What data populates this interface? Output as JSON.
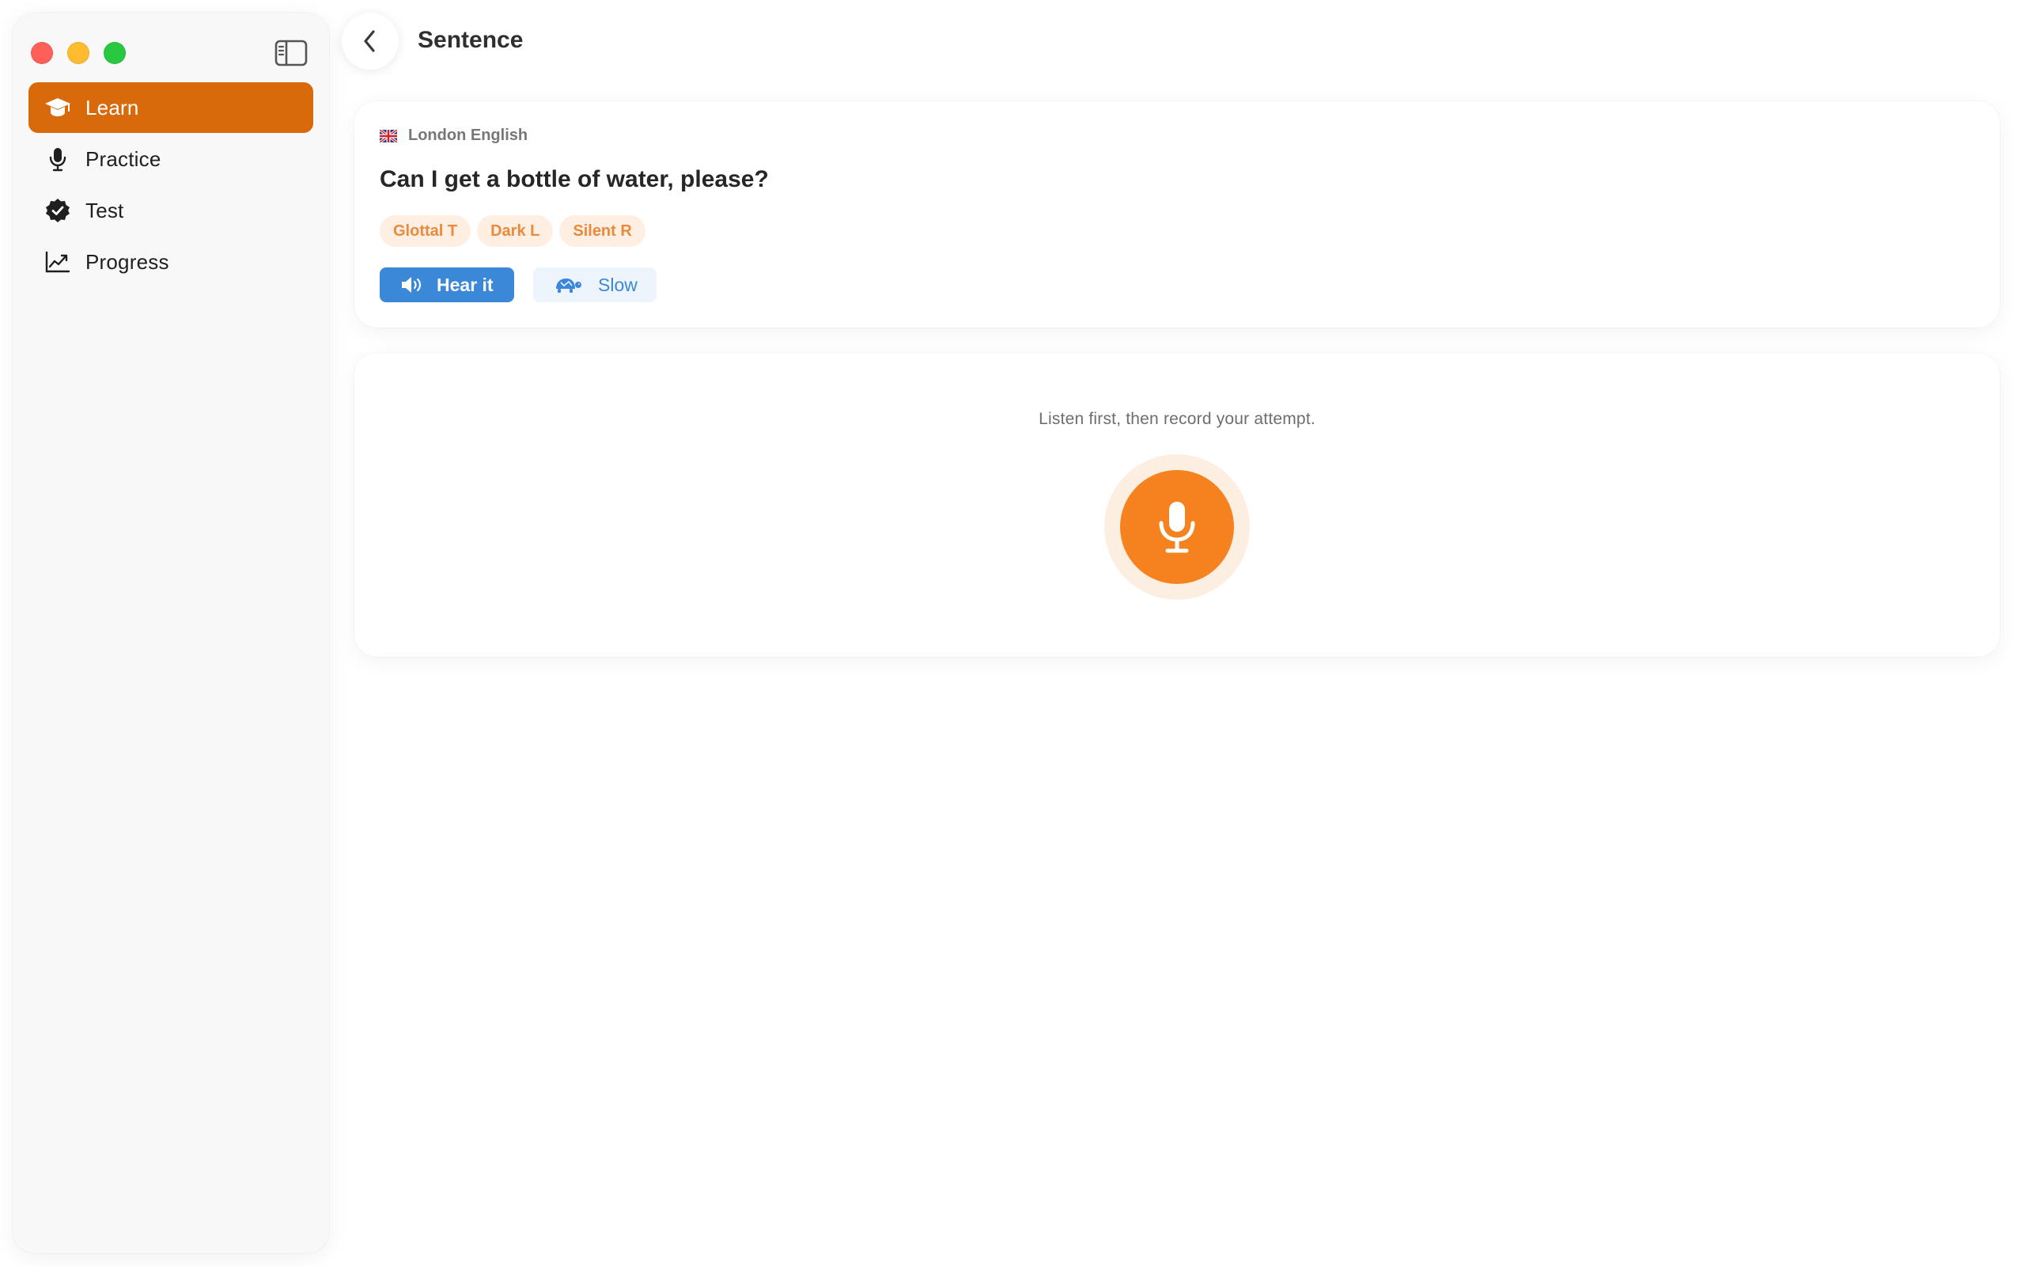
{
  "window": {
    "traffic_lights": {
      "close": "#fe5f57",
      "minimize": "#febc2e",
      "maximize": "#28c840"
    }
  },
  "sidebar": {
    "items": [
      {
        "label": "Learn",
        "icon": "graduation-cap-icon",
        "active": true
      },
      {
        "label": "Practice",
        "icon": "microphone-icon",
        "active": false
      },
      {
        "label": "Test",
        "icon": "checkmark-seal-icon",
        "active": false
      },
      {
        "label": "Progress",
        "icon": "line-chart-icon",
        "active": false
      }
    ],
    "active_color": "#d96a0b"
  },
  "header": {
    "title": "Sentence"
  },
  "sentence_card": {
    "accent": "London English",
    "accent_flag": "uk-flag-icon",
    "sentence": "Can I get a bottle of water, please?",
    "tags": [
      "Glottal T",
      "Dark L",
      "Silent R"
    ],
    "hear_label": "Hear it",
    "slow_label": "Slow"
  },
  "record_card": {
    "hint": "Listen first, then record your attempt.",
    "record_color": "#f5821f"
  }
}
